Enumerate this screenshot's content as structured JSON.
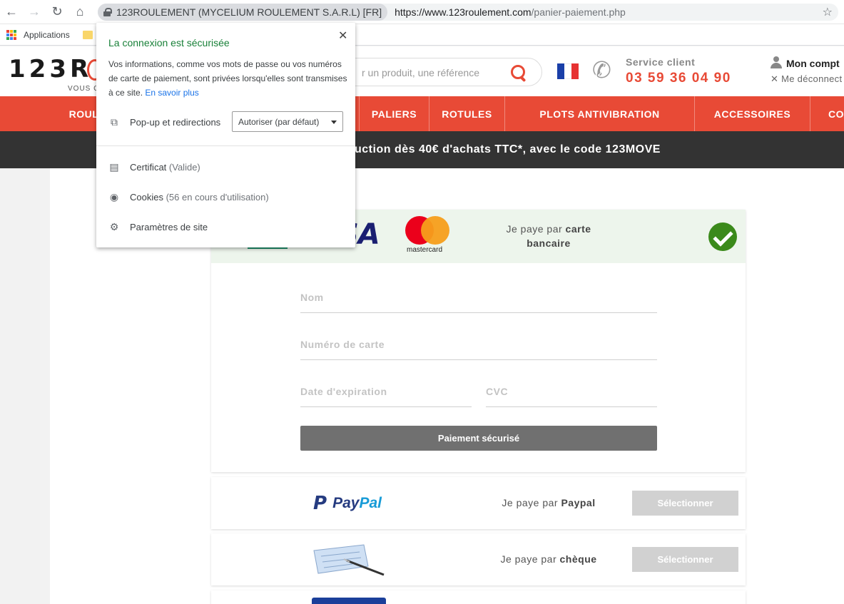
{
  "browser": {
    "site_identity": "123ROULEMENT (MYCELIUM ROULEMENT S.A.R.L) [FR]",
    "url_host": "https://www.123roulement.com",
    "url_path": "/panier-paiement.php",
    "bookmark_apps": "Applications"
  },
  "popup": {
    "title": "La connexion est sécurisée",
    "description": "Vos informations, comme vos mots de passe ou vos numéros de carte de paiement, sont privées lorsqu'elles sont transmises à ce site.",
    "learn_more": "En savoir plus",
    "popups_label": "Pop-up et redirections",
    "popups_value": "Autoriser (par défaut)",
    "certificate_label": "Certificat",
    "certificate_status": "(Valide)",
    "cookies_label": "Cookies",
    "cookies_status": "(56 en cours d'utilisation)",
    "site_settings": "Paramètres de site"
  },
  "header": {
    "logo": "123R",
    "tagline": "VOUS C",
    "search_placeholder": "r un produit, une référence",
    "service_label": "Service client",
    "service_phone": "03 59 36 04 90",
    "account_label": "Mon compt",
    "logout_label": "Me déconnect"
  },
  "nav": {
    "items": [
      "ROUL",
      "PALIERS",
      "ROTULES",
      "PLOTS ANTIVIBRATION",
      "ACCESSOIRES",
      "COU"
    ]
  },
  "promo": {
    "text": "uction dès 40€ d'achats TTC*, avec le code 123MOVE"
  },
  "payment": {
    "card": {
      "visa_text": "SA",
      "mastercard_text": "mastercard",
      "pay_prefix": "Je paye par",
      "pay_method": "carte bancaire",
      "field_name": "Nom",
      "field_number": "Numéro de carte",
      "field_expiry": "Date d'expiration",
      "field_cvc": "CVC",
      "submit": "Paiement sécurisé"
    },
    "paypal": {
      "logo_mark": "P",
      "logo_word1": "Pay",
      "logo_word2": "Pal",
      "pay_prefix": "Je paye par",
      "pay_method": "Paypal",
      "select": "Sélectionner"
    },
    "cheque": {
      "pay_prefix": "Je paye par",
      "pay_method": "chèque",
      "select": "Sélectionner"
    }
  },
  "colors": {
    "brand_red": "#e84a36",
    "secure_green": "#188038",
    "check_green": "#3b8a1b"
  }
}
